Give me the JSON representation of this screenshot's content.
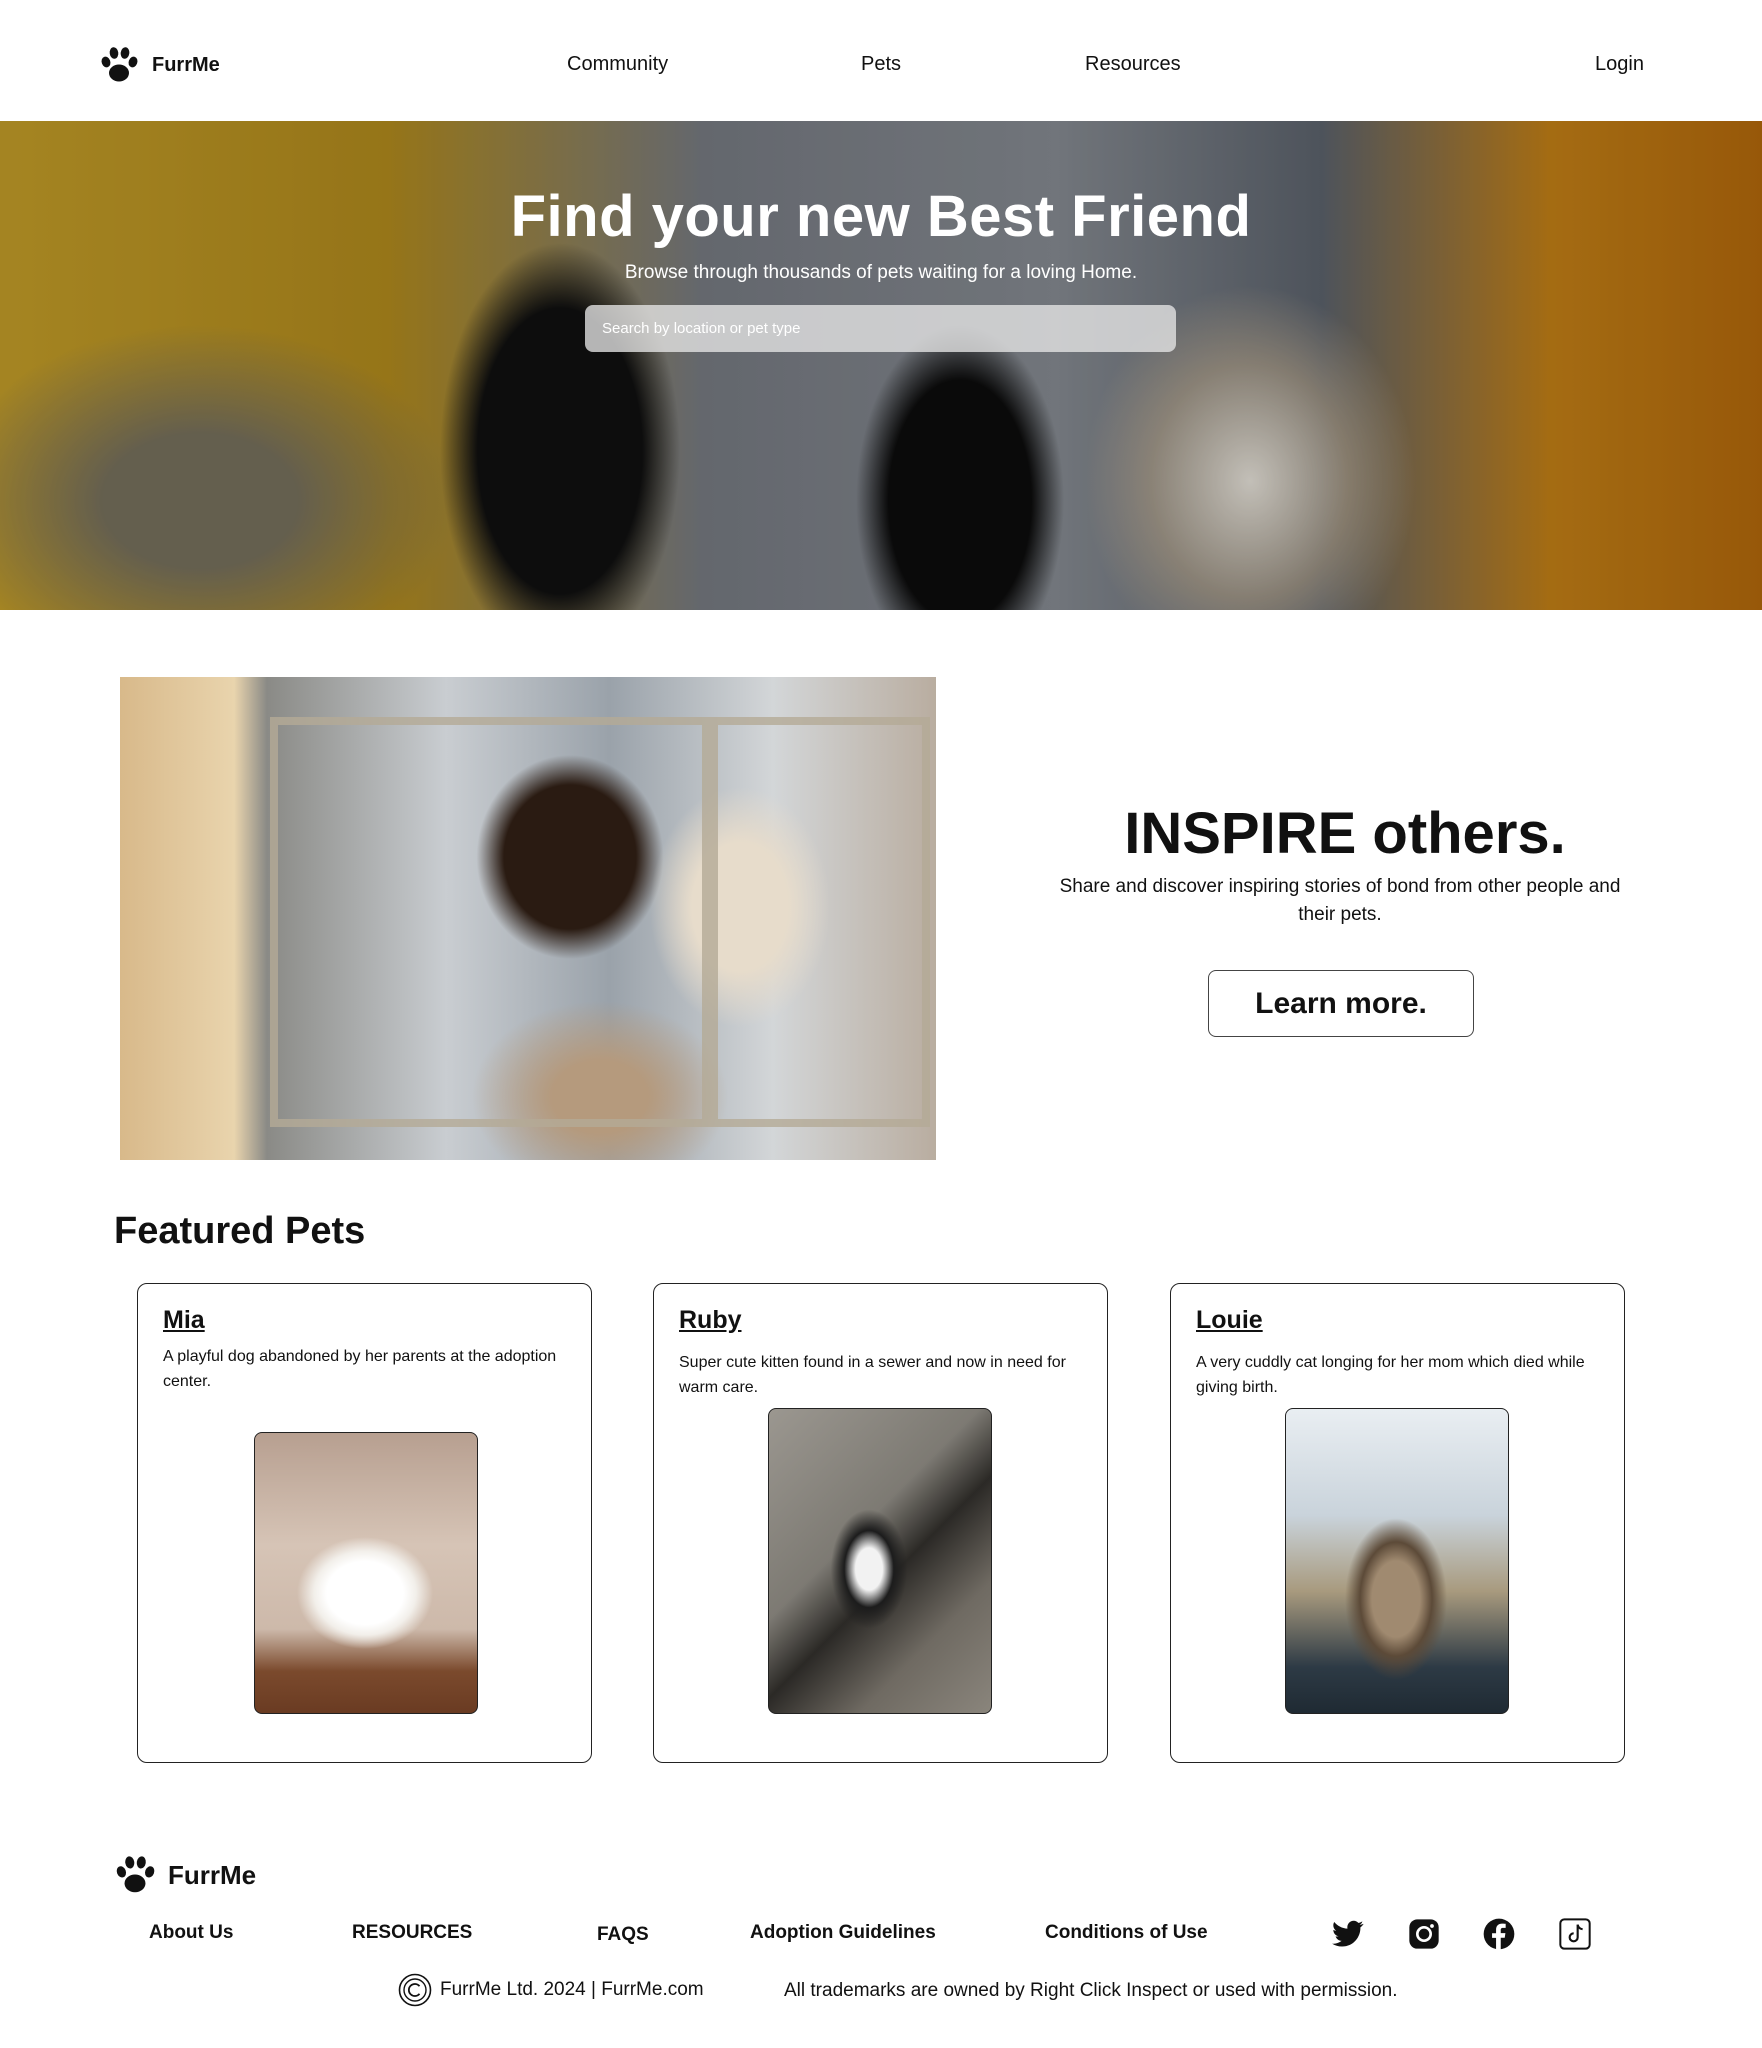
{
  "brand": {
    "name": "FurrMe",
    "icon": "paw-icon"
  },
  "nav": {
    "items": [
      {
        "label": "Community"
      },
      {
        "label": "Pets"
      },
      {
        "label": "Resources"
      }
    ],
    "login_label": "Login"
  },
  "hero": {
    "title": "Find your new Best Friend",
    "subtitle": "Browse through thousands of pets waiting for a loving Home.",
    "search_placeholder": "Search by location or pet type",
    "search_value": ""
  },
  "inspire": {
    "title": "INSPIRE others.",
    "text": "Share and discover inspiring stories of bond from other people and their pets.",
    "button_label": "Learn more."
  },
  "featured": {
    "title": "Featured Pets",
    "pets": [
      {
        "name": "Mia",
        "description": "A playful dog abandoned by her parents at the adoption center."
      },
      {
        "name": "Ruby",
        "description": "Super cute kitten found in a sewer and now in need for warm care."
      },
      {
        "name": "Louie",
        "description": "A very cuddly cat longing for her mom which died while giving birth."
      }
    ]
  },
  "footer": {
    "brand_name": "FurrMe",
    "links": [
      {
        "label": "About Us"
      },
      {
        "label": "RESOURCES"
      },
      {
        "label": "FAQS"
      },
      {
        "label": "Adoption Guidelines"
      },
      {
        "label": "Conditions of Use"
      }
    ],
    "social": [
      "twitter-icon",
      "instagram-icon",
      "facebook-icon",
      "tiktok-icon"
    ],
    "copyright": "FurrMe Ltd. 2024 | FurrMe.com",
    "trademark": "All trademarks are owned by Right Click Inspect or used with permission."
  }
}
